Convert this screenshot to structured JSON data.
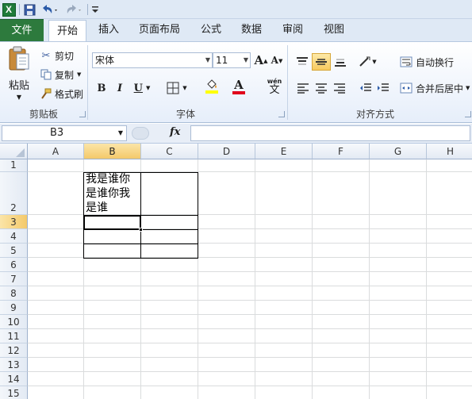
{
  "qat": {
    "logo_letter": "X",
    "icons": [
      "excel-logo-icon",
      "save-icon",
      "undo-icon",
      "redo-icon",
      "customize-qat-icon"
    ]
  },
  "tabs": {
    "file": "文件",
    "home": "开始",
    "insert": "插入",
    "page_layout": "页面布局",
    "formulas": "公式",
    "data": "数据",
    "review": "审阅",
    "view": "视图"
  },
  "clipboard": {
    "paste": "粘贴",
    "cut": "剪切",
    "copy": "复制",
    "format_painter": "格式刷",
    "group_label": "剪贴板"
  },
  "font": {
    "font_name": "宋体",
    "font_size": "11",
    "bold": "B",
    "italic": "I",
    "underline": "U",
    "grow": "A",
    "shrink": "A",
    "font_color_letter": "A",
    "phonetic_top": "wén",
    "phonetic_char": "文",
    "group_label": "字体",
    "highlight_color": "#ffff00",
    "font_color": "#e0001b"
  },
  "alignment": {
    "wrap_text": "自动换行",
    "merge_center": "合并后居中",
    "group_label": "对齐方式"
  },
  "formula_bar": {
    "name_box": "B3",
    "fx": "fx",
    "value": ""
  },
  "grid": {
    "columns": [
      "A",
      "B",
      "C",
      "D",
      "E",
      "F",
      "G",
      "H"
    ],
    "selected_column": "B",
    "rows": [
      "1",
      "2",
      "3",
      "4",
      "5",
      "6",
      "7",
      "8",
      "9",
      "10",
      "11",
      "12",
      "13",
      "14",
      "15"
    ],
    "selected_row": "3",
    "cells": {
      "B2": "我是谁你是谁你我是谁"
    }
  }
}
